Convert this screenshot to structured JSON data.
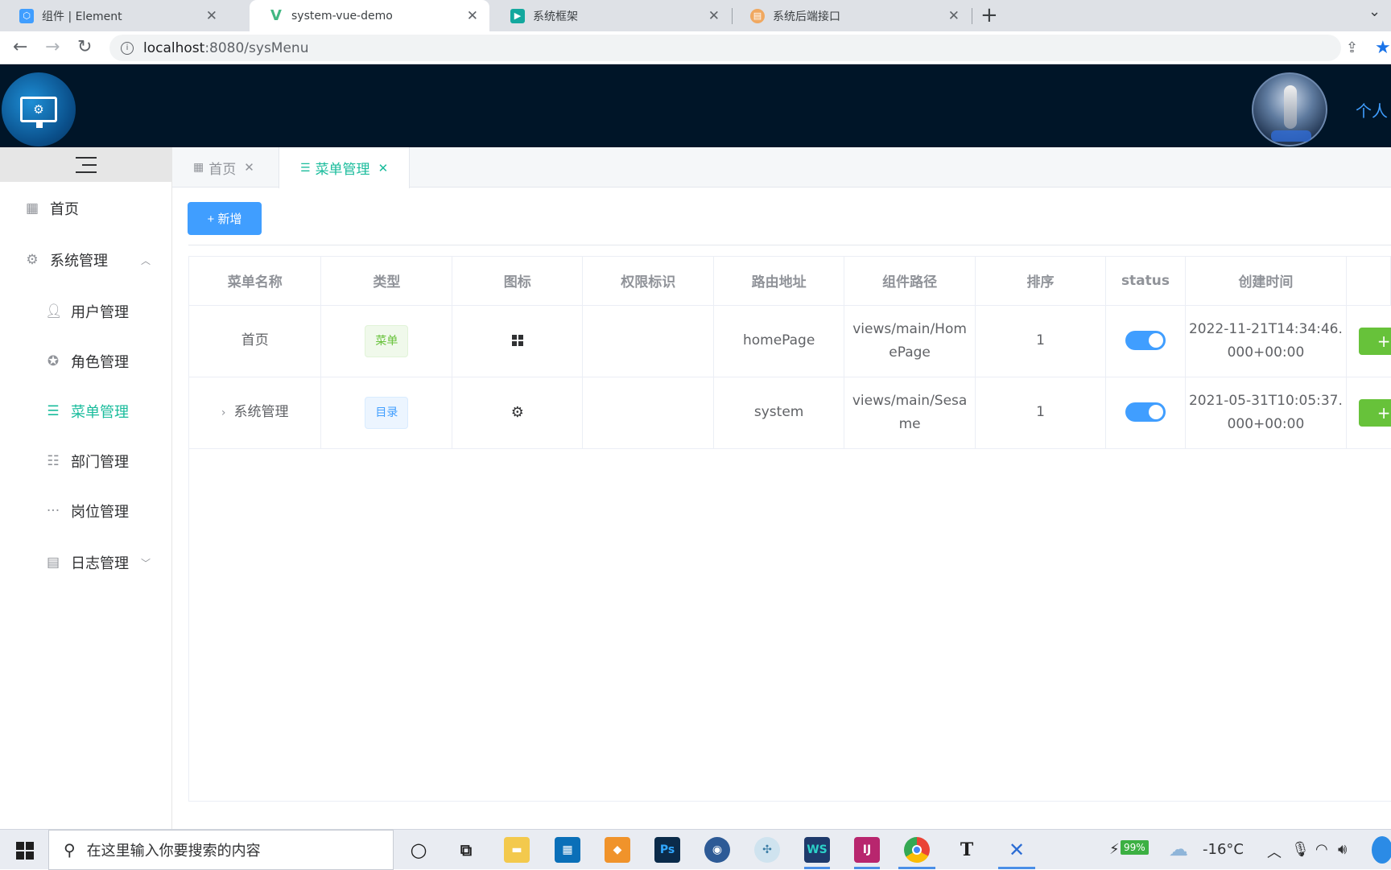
{
  "browser": {
    "tabs": [
      {
        "title": "组件 | Element",
        "favicon": "element-favicon"
      },
      {
        "title": "system-vue-demo",
        "favicon": "vue-favicon"
      },
      {
        "title": "系统框架",
        "favicon": "play-favicon"
      },
      {
        "title": "系统后端接口",
        "favicon": "doc-favicon"
      }
    ],
    "url_host": "localhost",
    "url_path": ":8080/sysMenu"
  },
  "header": {
    "user_link": "个人"
  },
  "sidebar": {
    "items": [
      {
        "label": "首页",
        "icon": "grid-icon"
      },
      {
        "label": "系统管理",
        "icon": "gear-icon"
      },
      {
        "label": "用户管理",
        "icon": "user-icon"
      },
      {
        "label": "角色管理",
        "icon": "role-icon"
      },
      {
        "label": "菜单管理",
        "icon": "menu-icon"
      },
      {
        "label": "部门管理",
        "icon": "sliders-icon"
      },
      {
        "label": "岗位管理",
        "icon": "more-icon"
      },
      {
        "label": "日志管理",
        "icon": "document-icon"
      }
    ]
  },
  "page_tabs": [
    {
      "label": "首页"
    },
    {
      "label": "菜单管理"
    }
  ],
  "toolbar": {
    "add_label": "+ 新增"
  },
  "table": {
    "headers": [
      "菜单名称",
      "类型",
      "图标",
      "权限标识",
      "路由地址",
      "组件路径",
      "排序",
      "status",
      "创建时间"
    ],
    "rows": [
      {
        "name": "首页",
        "type": "菜单",
        "icon": "grid-icon",
        "perm": "",
        "route": "homePage",
        "component_1": "views/main/Hom",
        "component_2": "ePage",
        "sort": "1",
        "status": true,
        "created_1": "2022-11-21T14:34:46.",
        "created_2": "000+00:00"
      },
      {
        "name": "系统管理",
        "type": "目录",
        "icon": "gear-icon",
        "perm": "",
        "route": "system",
        "component_1": "views/main/Sesa",
        "component_2": "me",
        "sort": "1",
        "status": true,
        "created_1": "2021-05-31T10:05:37.",
        "created_2": "000+00:00"
      }
    ],
    "op_label": "+"
  },
  "taskbar": {
    "search_placeholder": "在这里输入你要搜索的内容",
    "battery": "99%",
    "weather": "-16°C"
  },
  "colors": {
    "accent": "#1abc9c",
    "primary": "#409eff",
    "success": "#67c23a",
    "header_bg": "#001528"
  }
}
